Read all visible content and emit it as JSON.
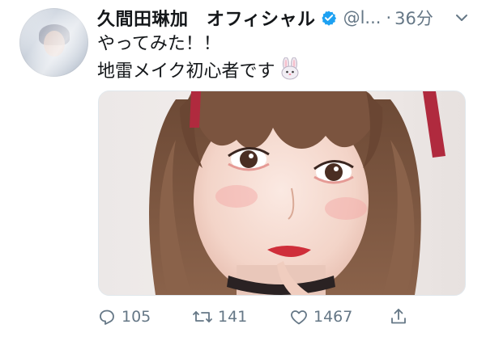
{
  "tweet": {
    "author": {
      "display_name": "久間田琳加　オフィシャル",
      "handle": "@l...",
      "verified": true
    },
    "separator": "·",
    "time": "36分",
    "text": {
      "line1": "やってみた！！",
      "line2": "地雷メイク初心者です"
    },
    "emoji": "rabbit-face",
    "actions": {
      "replies": "105",
      "retweets": "141",
      "likes": "1467"
    }
  },
  "colors": {
    "text": "#14171a",
    "secondary": "#657786",
    "verified_badge": "#1da1f2",
    "ribbon": "#b02a3e"
  },
  "icons": [
    "verified-badge-icon",
    "chevron-down-icon",
    "rabbit-emoji-icon",
    "reply-icon",
    "retweet-icon",
    "like-icon",
    "share-icon"
  ]
}
